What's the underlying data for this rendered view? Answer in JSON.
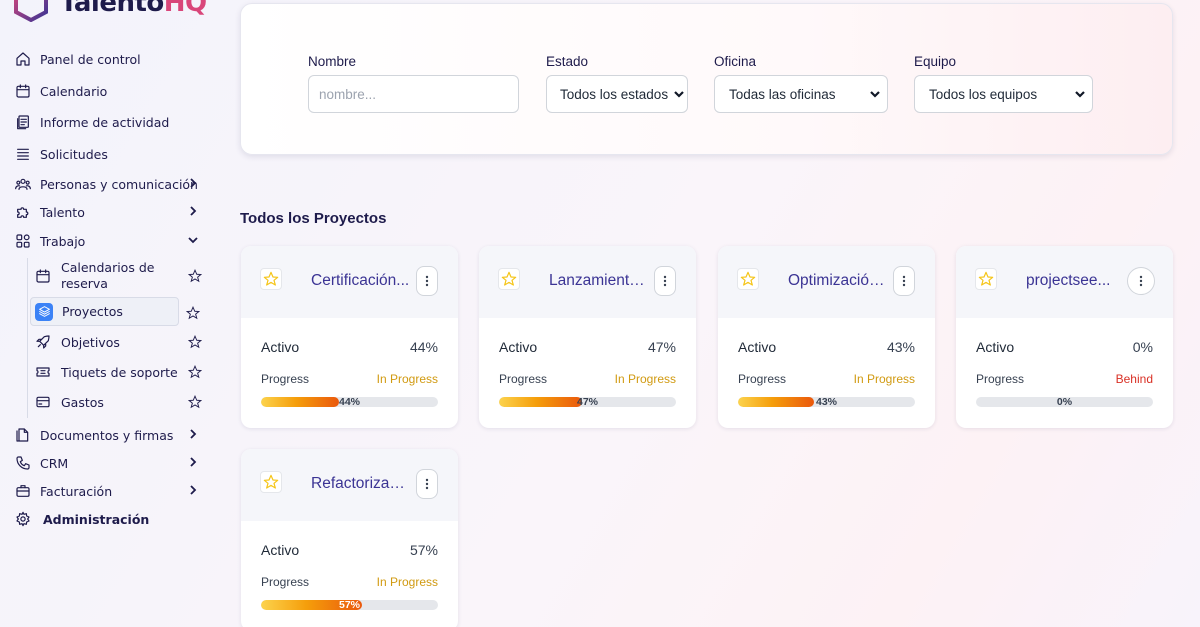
{
  "brand": {
    "name_main": "Talento",
    "name_accent": "HQ"
  },
  "colors": {
    "primary": "#1e1b4b",
    "project_title": "#3b3494",
    "accent_pink": "#d9467a",
    "in_progress": "#d19a11",
    "behind": "#d93025",
    "active_icon_bg": "#3b82f6"
  },
  "sidebar": {
    "items": [
      {
        "label": "Panel de control",
        "icon": "home-icon"
      },
      {
        "label": "Calendario",
        "icon": "calendar-icon"
      },
      {
        "label": "Informe de actividad",
        "icon": "report-icon"
      },
      {
        "label": "Solicitudes",
        "icon": "list-icon"
      },
      {
        "label": "Personas y comunicación",
        "icon": "people-icon"
      },
      {
        "label": "Talento",
        "icon": "puzzle-icon"
      },
      {
        "label": "Trabajo",
        "icon": "grid-icon"
      },
      {
        "label": "Documentos y firmas",
        "icon": "document-icon"
      },
      {
        "label": "CRM",
        "icon": "phone-icon"
      },
      {
        "label": "Facturación",
        "icon": "briefcase-icon"
      },
      {
        "label": "Administración",
        "icon": "gear-icon"
      }
    ],
    "work_subitems": [
      {
        "label": "Calendarios de reserva",
        "icon": "calendar-icon"
      },
      {
        "label": "Proyectos",
        "icon": "layers-icon",
        "active": true
      },
      {
        "label": "Objetivos",
        "icon": "rocket-icon"
      },
      {
        "label": "Tiquets de soporte",
        "icon": "ticket-icon"
      },
      {
        "label": "Gastos",
        "icon": "card-icon"
      }
    ]
  },
  "filters": {
    "name": {
      "label": "Nombre",
      "placeholder": "nombre..."
    },
    "state": {
      "label": "Estado",
      "value": "Todos los estados"
    },
    "office": {
      "label": "Oficina",
      "value": "Todas las oficinas"
    },
    "team": {
      "label": "Equipo",
      "value": "Todos los equipos"
    }
  },
  "projects_section": {
    "title": "Todos los Proyectos"
  },
  "projects": [
    {
      "name": "Certificación...",
      "state": "Activo",
      "percent": "44%",
      "progress_label": "Progress",
      "status": "In Progress",
      "progress": 0.44
    },
    {
      "name": "Lanzamiento...",
      "state": "Activo",
      "percent": "47%",
      "progress_label": "Progress",
      "status": "In Progress",
      "progress": 0.47
    },
    {
      "name": "Optimización...",
      "state": "Activo",
      "percent": "43%",
      "progress_label": "Progress",
      "status": "In Progress",
      "progress": 0.43
    },
    {
      "name": "projectsee...",
      "state": "Activo",
      "percent": "0%",
      "progress_label": "Progress",
      "status": "Behind",
      "progress": 0
    },
    {
      "name": "Refactorizaci...",
      "state": "Activo",
      "percent": "57%",
      "progress_label": "Progress",
      "status": "In Progress",
      "progress": 0.57
    }
  ]
}
